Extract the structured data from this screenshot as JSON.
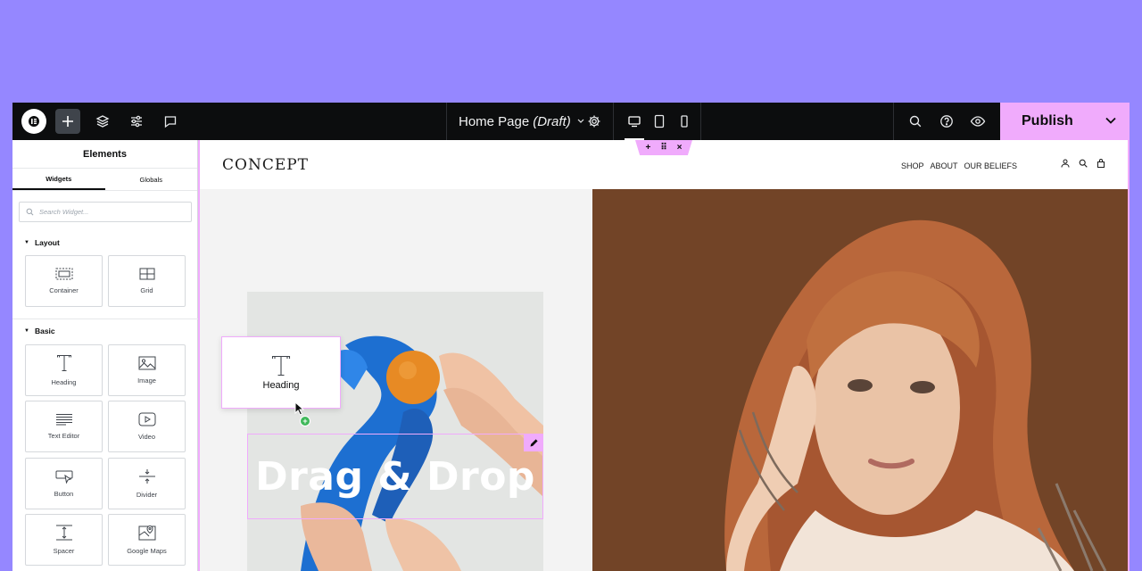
{
  "topbar": {
    "page_title": "Home Page",
    "page_status": "(Draft)",
    "publish_label": "Publish",
    "icons": [
      "elementor-logo",
      "plus-icon",
      "layers-icon",
      "sliders-icon",
      "comment-icon",
      "settings-icon",
      "desktop-icon",
      "tablet-icon",
      "mobile-icon",
      "search-icon",
      "help-icon",
      "eye-icon",
      "chevron-down-icon"
    ]
  },
  "panel": {
    "title": "Elements",
    "tabs": [
      "Widgets",
      "Globals"
    ],
    "active_tab": "Widgets",
    "search_placeholder": "Search Widget...",
    "categories": [
      {
        "name": "Layout",
        "widgets": [
          "Container",
          "Grid"
        ]
      },
      {
        "name": "Basic",
        "widgets": [
          "Heading",
          "Image",
          "Text Editor",
          "Video",
          "Button",
          "Divider",
          "Spacer",
          "Google Maps"
        ]
      }
    ]
  },
  "site": {
    "logo": "CONCEPT",
    "nav": [
      "SHOP",
      "ABOUT",
      "OUR BELIEFS"
    ],
    "heading": "Drag & Drop"
  },
  "drag": {
    "label": "Heading"
  },
  "colors": {
    "background": "#9587ff",
    "accent": "#f0abfc",
    "topbar": "#0c0d0e"
  }
}
